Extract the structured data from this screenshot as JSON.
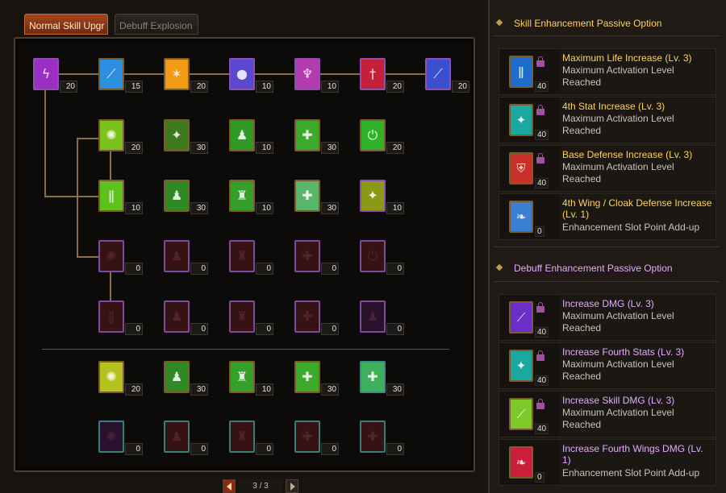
{
  "tabs": [
    {
      "label": "Normal Skill Upgr",
      "active": true
    },
    {
      "label": "Debuff Explosion",
      "active": false
    }
  ],
  "tree": {
    "rows": [
      {
        "level": [
          "20",
          "15",
          "20",
          "10",
          "10",
          "20",
          "20"
        ]
      },
      {
        "level": [
          "20",
          "30",
          "10",
          "30",
          "20"
        ]
      },
      {
        "level": [
          "10",
          "30",
          "10",
          "30",
          "10"
        ]
      },
      {
        "level": [
          "0",
          "0",
          "0",
          "0",
          "0"
        ]
      },
      {
        "level": [
          "0",
          "0",
          "0",
          "0",
          "0"
        ]
      },
      {
        "level": [
          "20",
          "30",
          "10",
          "30",
          "30"
        ]
      },
      {
        "level": [
          "0",
          "0",
          "0",
          "0",
          "0"
        ]
      }
    ],
    "colors": {
      "row0": [
        "#9b2fc4",
        "#2c8fe0",
        "#f29a14",
        "#5a48d0",
        "#b43ab0",
        "#c4203a",
        "#3a4fd0"
      ],
      "green": "#4fb82a",
      "yellow": "#b3c21e",
      "locked": "#3a1212"
    }
  },
  "pager": {
    "text": "3 / 3"
  },
  "skill_section": {
    "title": "Skill Enhancement Passive Option",
    "options": [
      {
        "title": "Maximum Life Increase (Lv. 3)",
        "status": "Maximum Activation Level Reached",
        "level": "40",
        "icon": "life-icon",
        "color": "#1e6dc8"
      },
      {
        "title": "4th Stat Increase (Lv. 3)",
        "status": "Maximum Activation Level Reached",
        "level": "40",
        "icon": "stat-icon",
        "color": "#1aa8a0"
      },
      {
        "title": "Base Defense Increase (Lv. 3)",
        "status": "Maximum Activation Level Reached",
        "level": "40",
        "icon": "shield-icon",
        "color": "#c8302a"
      },
      {
        "title": "4th Wing / Cloak Defense Increase (Lv. 1)",
        "status": "Enhancement Slot Point Add-up",
        "level": "0",
        "icon": "wing-icon",
        "color": "#3a7fd0"
      }
    ]
  },
  "debuff_section": {
    "title": "Debuff Enhancement Passive Option",
    "options": [
      {
        "title": "Increase DMG (Lv. 3)",
        "status": "Maximum Activation Level Reached",
        "level": "40",
        "icon": "sword-icon",
        "color": "#6a2fc8"
      },
      {
        "title": "Increase Fourth Stats (Lv. 3)",
        "status": "Maximum Activation Level Reached",
        "level": "40",
        "icon": "stat-icon",
        "color": "#1aa8a0"
      },
      {
        "title": "Increase Skill DMG (Lv. 3)",
        "status": "Maximum Activation Level Reached",
        "level": "40",
        "icon": "slash-icon",
        "color": "#7fc82a"
      },
      {
        "title": "Increase Fourth Wings DMG (Lv. 1)",
        "status": "Enhancement Slot Point Add-up",
        "level": "0",
        "icon": "wing-icon",
        "color": "#c8203a"
      }
    ]
  }
}
